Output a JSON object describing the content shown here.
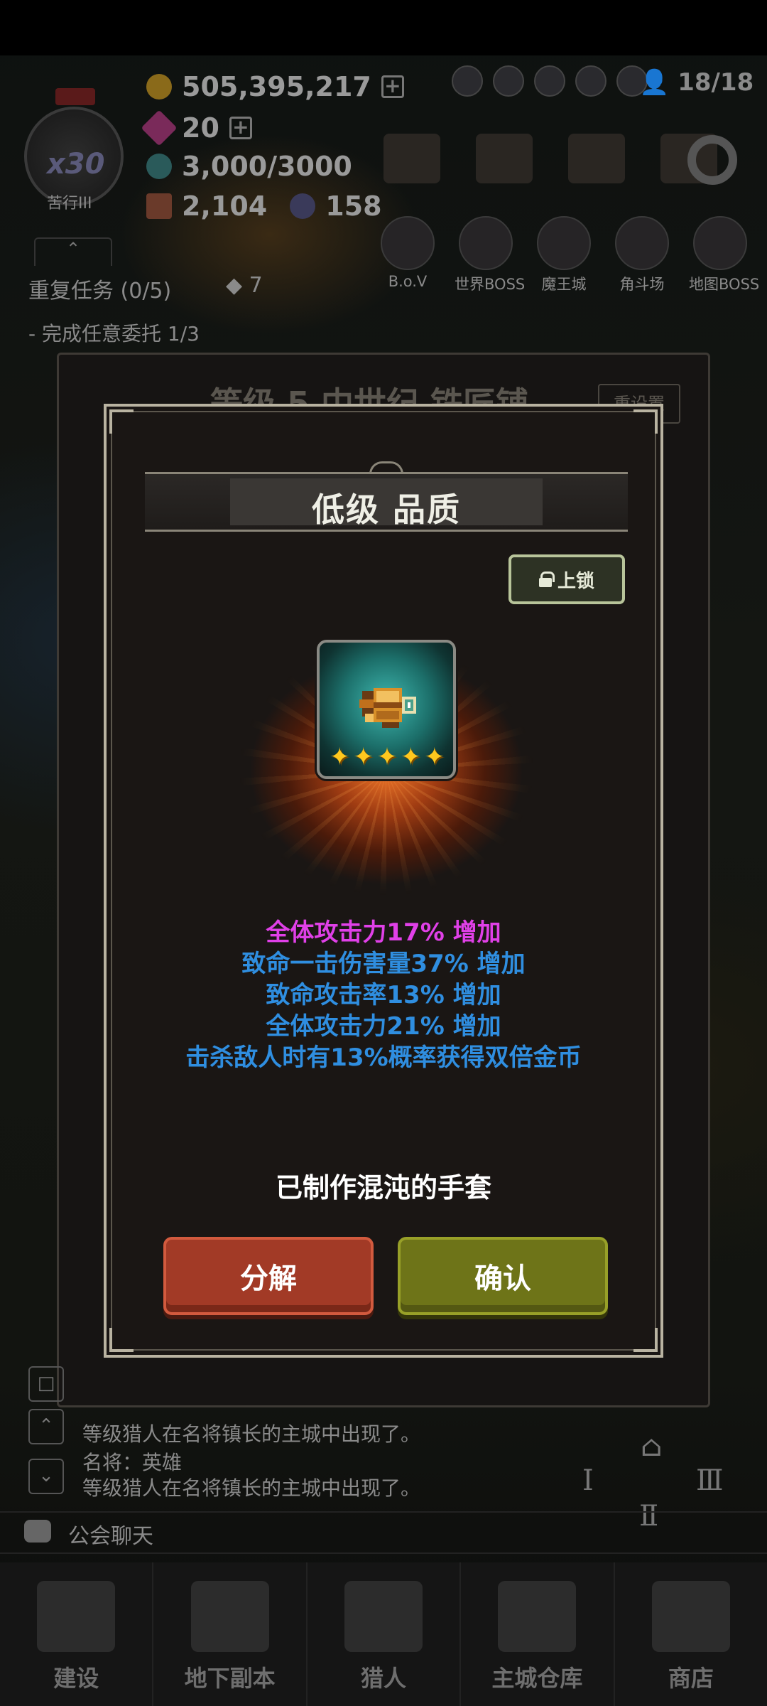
{
  "resources": {
    "gold": "505,395,217",
    "gems": "20",
    "energy": "3,000/3000",
    "materials": "2,104",
    "crystals": "158",
    "quota": "18/18"
  },
  "player": {
    "multiplier": "x30",
    "rank": "苦行III"
  },
  "boss_menu": [
    "B.o.V",
    "世界BOSS",
    "魔王城",
    "角斗场",
    "地图BOSS"
  ],
  "quest": {
    "title": "重复任务 (0/5)",
    "gem_reward": "7",
    "subtask": "-  完成任意委托 1/3"
  },
  "underpanel": {
    "title": "等级 5 中世纪 铁匠铺",
    "reset_label": "重设置"
  },
  "modal": {
    "title": "低级 品质",
    "lock_label": "上锁",
    "star_count": 5,
    "stats": [
      {
        "text": "全体攻击力17% 增加",
        "color": "#e040e8"
      },
      {
        "text": "致命一击伤害量37% 增加",
        "color": "#2f8ee0"
      },
      {
        "text": "致命攻击率13% 增加",
        "color": "#2f8ee0"
      },
      {
        "text": "全体攻击力21% 增加",
        "color": "#2f8ee0"
      },
      {
        "text": "击杀敌人时有13%概率获得双倍金币",
        "color": "#2f8ee0"
      }
    ],
    "crafted_text": "已制作混沌的手套",
    "disassemble_label": "分解",
    "confirm_label": "确认"
  },
  "chat": {
    "line1_name": "名将：英雄",
    "line1_msg": "等级猎人在名将镇长的主城中出现了。",
    "line2_name": "名将：英雄",
    "line2_msg": "等级猎人在名将镇长的主城中出现了。",
    "guild_label": "公会聊天"
  },
  "bottom_nav": [
    "建设",
    "地下副本",
    "猎人",
    "主城仓库",
    "商店"
  ],
  "colors": {
    "accent_red": "#a23a26",
    "accent_green": "#6e7418",
    "stat_pink": "#e040e8",
    "stat_blue": "#2f8ee0"
  }
}
